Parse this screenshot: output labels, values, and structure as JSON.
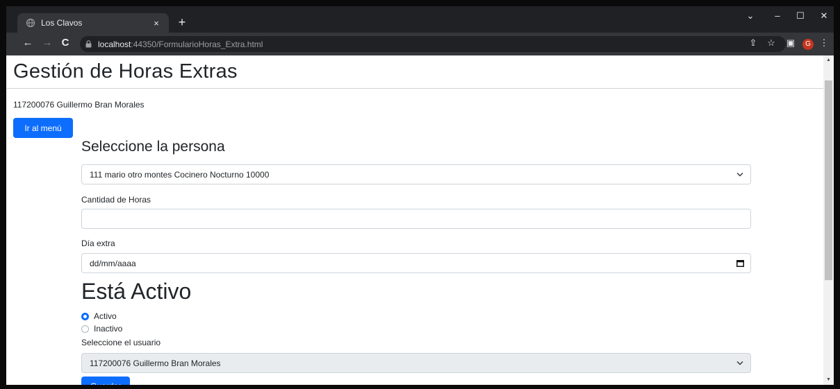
{
  "browser": {
    "tab_title": "Los Clavos",
    "tab_close": "×",
    "new_tab": "+",
    "url_host": "localhost",
    "url_rest": ":44350/FormularioHoras_Extra.html",
    "profile_initial": "G"
  },
  "page": {
    "title": "Gestión de Horas Extras",
    "current_user": "117200076 Guillermo Bran Morales",
    "menu_button": "Ir al menú"
  },
  "form": {
    "person_heading": "Seleccione la persona",
    "person_selected": "111 mario otro montes Cocinero Nocturno 10000",
    "hours_label": "Cantidad de Horas",
    "hours_value": "",
    "day_label": "Día extra",
    "day_placeholder": "dd/mm/aaaa",
    "active_heading": "Está Activo",
    "radio_active": "Activo",
    "radio_inactive": "Inactivo",
    "active_selected": "Activo",
    "user_label": "Seleccione el usuario",
    "user_selected": "117200076 Guillermo Bran Morales",
    "save_button": "Guardar"
  },
  "colors": {
    "primary": "#0d6efd",
    "browser_dark": "#202124",
    "browser_toolbar": "#35363a"
  },
  "icons": [
    "globe-icon",
    "close-icon",
    "back-icon",
    "forward-icon",
    "reload-icon",
    "lock-icon",
    "share-icon",
    "star-icon",
    "sidepanel-icon",
    "menu-dots-icon",
    "chevron-down-icon",
    "calendar-icon"
  ]
}
